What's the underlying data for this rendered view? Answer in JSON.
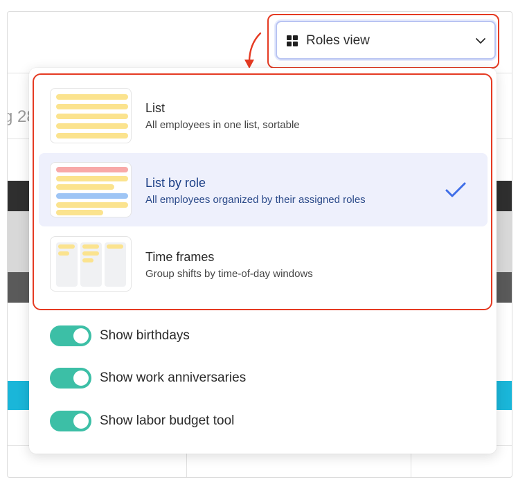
{
  "background": {
    "date_fragment": "g 28"
  },
  "view_select": {
    "label": "Roles view",
    "icon": "grid-icon"
  },
  "options": [
    {
      "title": "List",
      "description": "All employees in one list, sortable",
      "selected": false
    },
    {
      "title": "List by role",
      "description": "All employees organized by their assigned roles",
      "selected": true
    },
    {
      "title": "Time frames",
      "description": "Group shifts by time-of-day windows",
      "selected": false
    }
  ],
  "toggles": [
    {
      "label": "Show birthdays",
      "on": true
    },
    {
      "label": "Show work anniversaries",
      "on": true
    },
    {
      "label": "Show labor budget tool",
      "on": true
    }
  ],
  "colors": {
    "highlight_red": "#e53a22",
    "selected_bg": "#eef0fc",
    "selected_text": "#1c3f86",
    "check": "#3f6ee8",
    "toggle_on": "#3cbfa6",
    "thumb_yellow": "#fbe38e",
    "thumb_red": "#f8a9a8",
    "thumb_blue": "#9ec5f5",
    "bg_dark_band": "#2f2f2f",
    "bg_cyan_band": "#1ab6d9"
  }
}
